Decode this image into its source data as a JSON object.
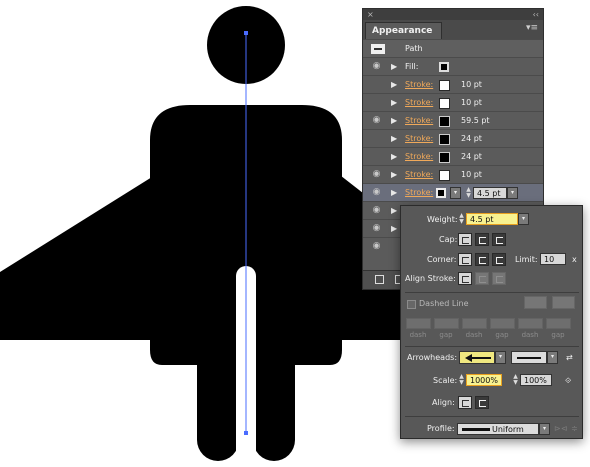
{
  "panel": {
    "close_glyph": "×",
    "collapse_glyph": "‹‹",
    "tab_label": "Appearance",
    "menu_glyph": "▾≡",
    "header_label": "Path",
    "rows": [
      {
        "label": "Fill:",
        "value": "",
        "kind": "fill",
        "eye": true
      },
      {
        "label": "Stroke:",
        "value": "10 pt",
        "kind": "stroke-white",
        "eye": false
      },
      {
        "label": "Stroke:",
        "value": "10 pt",
        "kind": "stroke-white",
        "eye": false
      },
      {
        "label": "Stroke:",
        "value": "59.5 pt",
        "kind": "stroke-black",
        "eye": true
      },
      {
        "label": "Stroke:",
        "value": "24 pt",
        "kind": "stroke-black",
        "eye": false
      },
      {
        "label": "Stroke:",
        "value": "24 pt",
        "kind": "stroke-black",
        "eye": false
      },
      {
        "label": "Stroke:",
        "value": "10 pt",
        "kind": "stroke-white",
        "eye": true
      },
      {
        "label": "Stroke:",
        "value": "4.5 pt",
        "kind": "selected",
        "eye": true
      }
    ]
  },
  "flyout": {
    "weight_label": "Weight:",
    "weight_value": "4.5 pt",
    "cap_label": "Cap:",
    "corner_label": "Corner:",
    "limit_label": "Limit:",
    "limit_value": "10",
    "limit_unit": "x",
    "align_stroke_label": "Align Stroke:",
    "dashed_line_label": "Dashed Line",
    "dash_labels": [
      "dash",
      "gap",
      "dash",
      "gap",
      "dash",
      "gap"
    ],
    "arrowheads_label": "Arrowheads:",
    "scale_label": "Scale:",
    "scale_start": "1000%",
    "scale_end": "100%",
    "align_label": "Align:",
    "profile_label": "Profile:",
    "profile_value": "Uniform"
  },
  "colors": {
    "figure": "#000000",
    "path_line": "#4a6cff",
    "panel_bg": "#5b5b5b",
    "label_orange": "#f0a95a",
    "highlight": "#f8f290"
  }
}
